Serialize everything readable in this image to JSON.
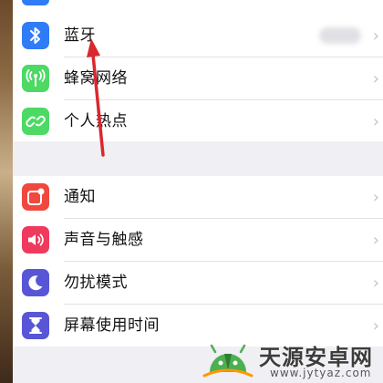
{
  "settings": {
    "items": [
      {
        "label": "蓝牙",
        "icon": "bluetooth-icon",
        "color": "#2f7cf6"
      },
      {
        "label": "蜂窝网络",
        "icon": "cellular-antenna-icon",
        "color": "#4cd964"
      },
      {
        "label": "个人热点",
        "icon": "personal-hotspot-icon",
        "color": "#4cd964"
      },
      {
        "label": "通知",
        "icon": "notification-icon",
        "color": "#f0483e"
      },
      {
        "label": "声音与触感",
        "icon": "speaker-icon",
        "color": "#ef3a5d"
      },
      {
        "label": "勿扰模式",
        "icon": "moon-icon",
        "color": "#5856d6"
      },
      {
        "label": "屏幕使用时间",
        "icon": "hourglass-icon",
        "color": "#5856d6"
      }
    ],
    "chevron": "›"
  },
  "watermark": {
    "title": "天源安卓网",
    "url": "www.jytyaz.com"
  }
}
